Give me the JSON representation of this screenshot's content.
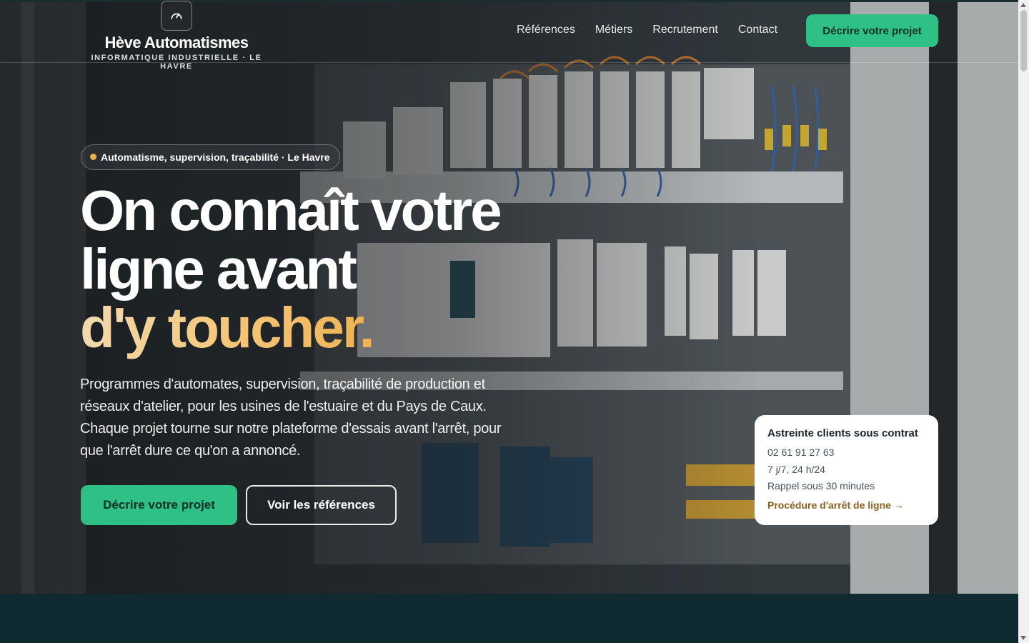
{
  "brand": {
    "name": "Hève Automatismes",
    "tagline": "INFORMATIQUE INDUSTRIELLE · LE HAVRE",
    "logo_icon": "gauge-icon"
  },
  "nav": {
    "items": [
      {
        "label": "Références"
      },
      {
        "label": "Métiers"
      },
      {
        "label": "Recrutement"
      },
      {
        "label": "Contact"
      }
    ],
    "cta_label": "Décrire votre projet"
  },
  "hero": {
    "badge": "Automatisme, supervision, traçabilité · Le Havre",
    "headline": {
      "line1": "On connaît votre",
      "line2": "ligne avant",
      "line3": "d'y toucher."
    },
    "lede": "Programmes d'automates, supervision, traçabilité de production et réseaux d'atelier, pour les usines de l'estuaire et du Pays de Caux. Chaque projet tourne sur notre plateforme d'essais avant l'arrêt, pour que l'arrêt dure ce qu'on a annoncé.",
    "primary_cta": "Décrire votre projet",
    "secondary_cta": "Voir les références"
  },
  "oncall_card": {
    "title": "Astreinte clients sous contrat",
    "phone": "02 61 91 27 63",
    "hours": "7 j/7, 24 h/24",
    "callback": "Rappel sous 30 minutes",
    "link": "Procédure d'arrêt de ligne →"
  },
  "colors": {
    "accent_green": "#2fc085",
    "accent_gold": "#f5c77a",
    "dark_teal": "#0f2a30",
    "link_brown": "#8a6320"
  }
}
